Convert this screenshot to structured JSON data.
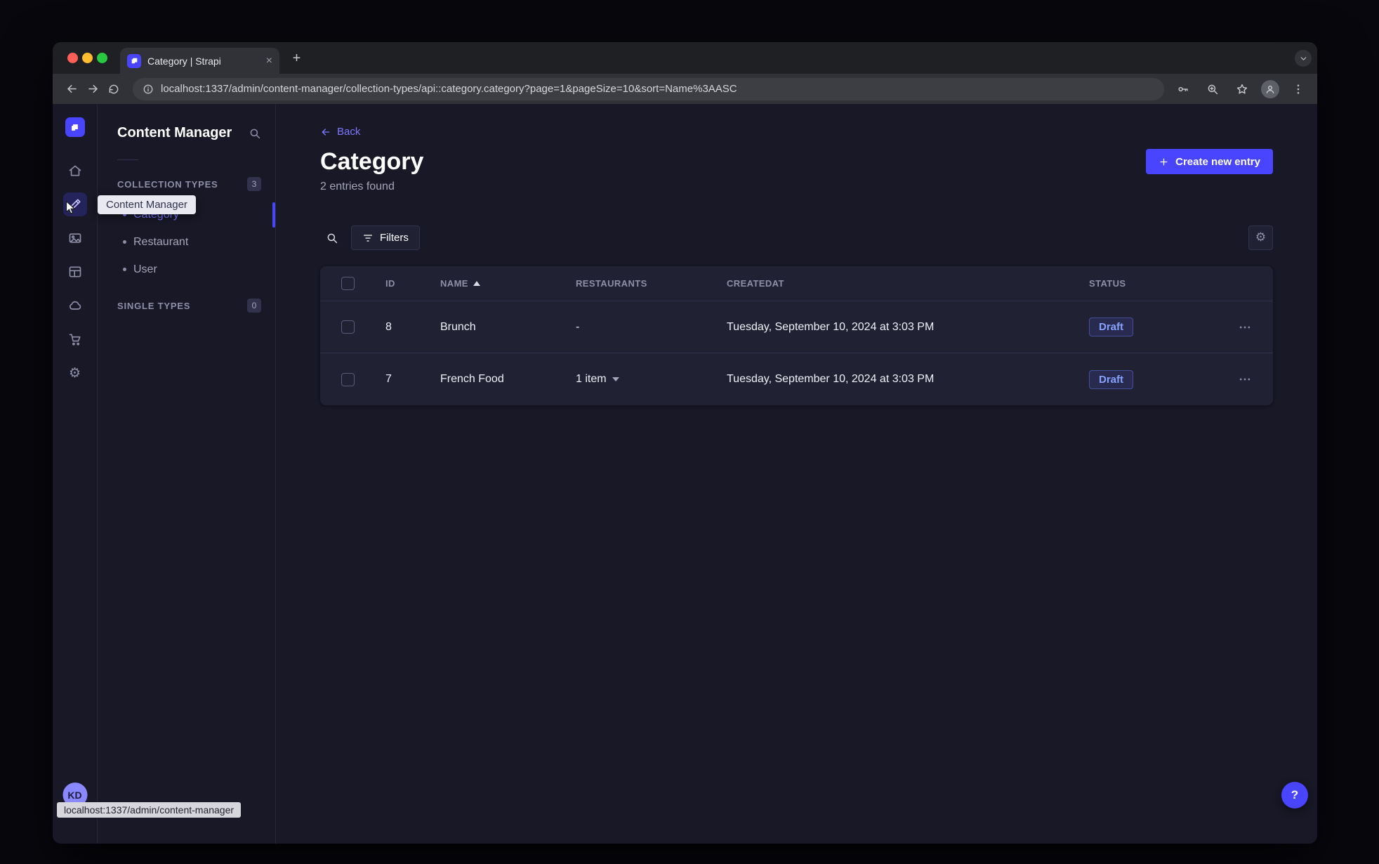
{
  "browser": {
    "tab_title": "Category | Strapi",
    "url": "localhost:1337/admin/content-manager/collection-types/api::category.category?page=1&pageSize=10&sort=Name%3AASC",
    "status_bubble": "localhost:1337/admin/content-manager"
  },
  "rail": {
    "tooltip": "Content Manager",
    "avatar_initials": "KD"
  },
  "subnav": {
    "title": "Content Manager",
    "sections": [
      {
        "label": "COLLECTION TYPES",
        "badge": "3",
        "items": [
          {
            "label": "Category"
          },
          {
            "label": "Restaurant"
          },
          {
            "label": "User"
          }
        ]
      },
      {
        "label": "SINGLE TYPES",
        "badge": "0",
        "items": []
      }
    ]
  },
  "main": {
    "back_label": "Back",
    "title": "Category",
    "subtitle": "2 entries found",
    "create_button_label": "Create new entry",
    "filters_button_label": "Filters",
    "help_button_label": "?",
    "table": {
      "columns": [
        "ID",
        "NAME",
        "RESTAURANTS",
        "CREATEDAT",
        "STATUS"
      ],
      "rows": [
        {
          "id": "8",
          "name": "Brunch",
          "restaurants": "-",
          "createdat": "Tuesday, September 10, 2024 at 3:03 PM",
          "status": "Draft"
        },
        {
          "id": "7",
          "name": "French Food",
          "restaurants": "1 item",
          "createdat": "Tuesday, September 10, 2024 at 3:03 PM",
          "status": "Draft"
        }
      ]
    }
  },
  "colors": {
    "accent": "#4945ff",
    "link": "#7b79ff",
    "draft_text": "#86a2ff"
  }
}
